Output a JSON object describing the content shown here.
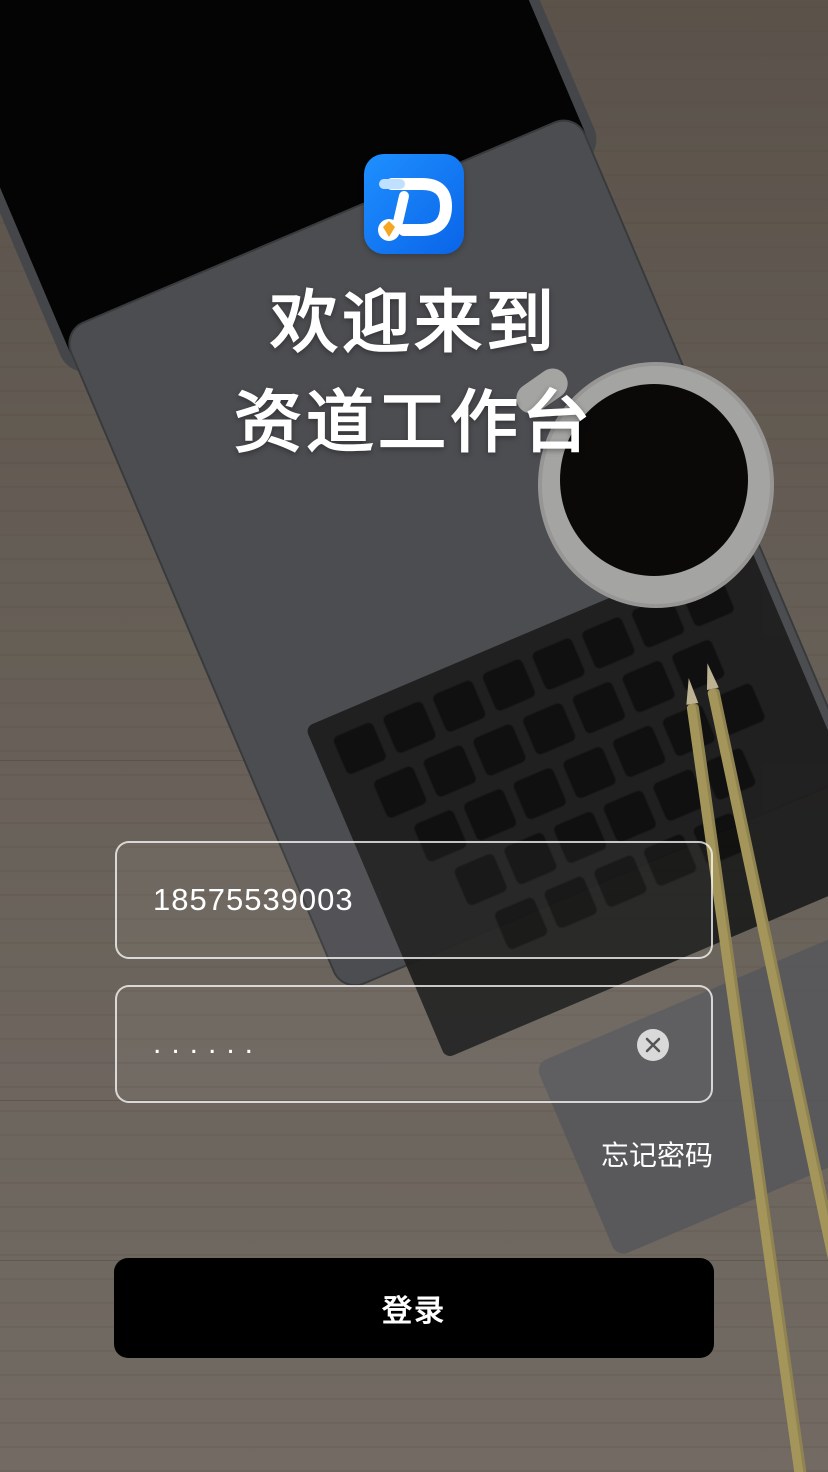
{
  "welcome": {
    "line1": "欢迎来到",
    "line2": "资道工作台"
  },
  "form": {
    "username_value": "18575539003",
    "password_value": "......",
    "forgot_password": "忘记密码",
    "login_button": "登录"
  },
  "icons": {
    "logo": "app-logo-icon",
    "clear": "clear-input-icon"
  },
  "colors": {
    "logo_blue": "#1e90ff",
    "button_bg": "#000000",
    "text": "#ffffff"
  }
}
